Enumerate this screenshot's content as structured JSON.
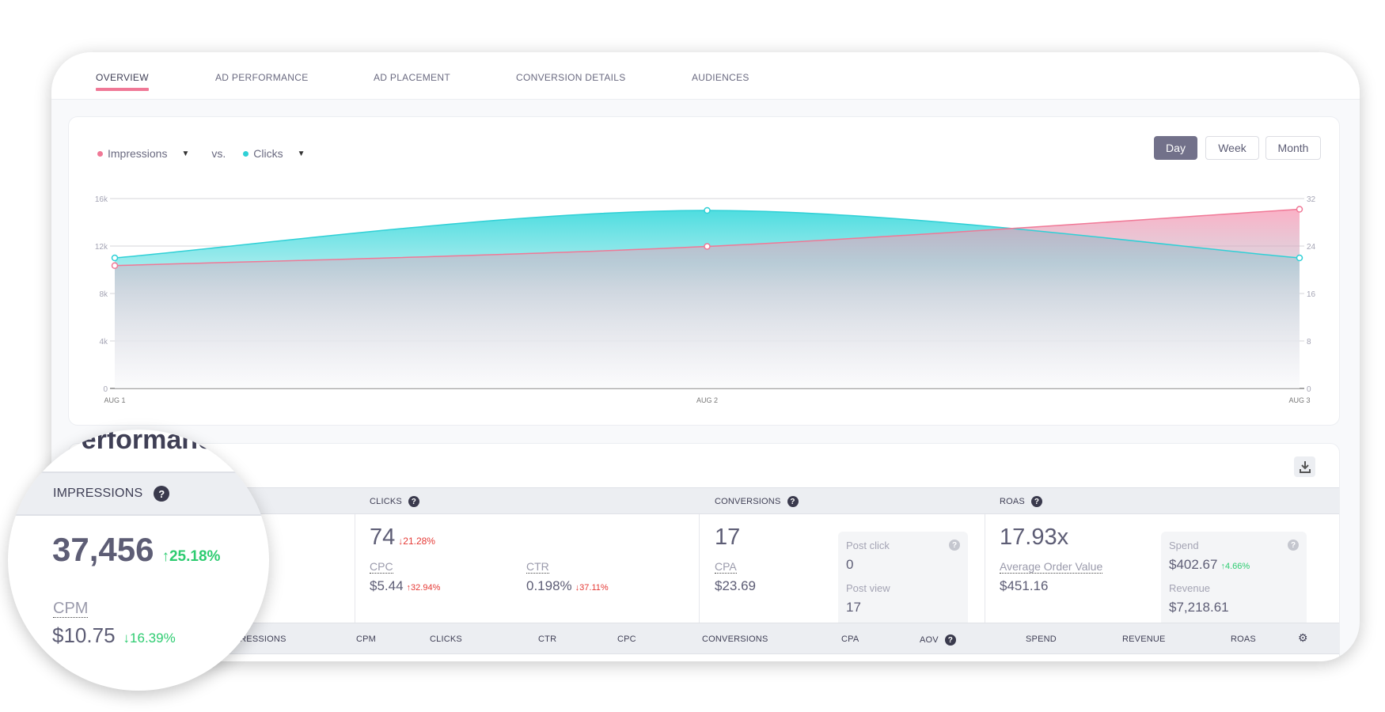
{
  "tabs": [
    {
      "label": "OVERVIEW",
      "active": true
    },
    {
      "label": "AD PERFORMANCE"
    },
    {
      "label": "AD PLACEMENT"
    },
    {
      "label": "CONVERSION DETAILS"
    },
    {
      "label": "AUDIENCES"
    }
  ],
  "legend": {
    "metric1": "Impressions",
    "vs": "vs.",
    "metric2": "Clicks"
  },
  "periods": {
    "day": "Day",
    "week": "Week",
    "month": "Month",
    "selected": "Day"
  },
  "colors": {
    "impressions": "#f07896",
    "clicks": "#2fd0d6",
    "up": "#2ecc71",
    "down": "#e53935"
  },
  "chart_data": {
    "type": "area",
    "x": [
      "AUG 1",
      "AUG 2",
      "AUG 3"
    ],
    "series": [
      {
        "name": "Impressions",
        "axis": "left",
        "values": [
          10350,
          11970,
          15100
        ]
      },
      {
        "name": "Clicks",
        "axis": "right",
        "values": [
          22,
          30,
          22
        ]
      }
    ],
    "y_left": {
      "ticks": [
        "0",
        "4k",
        "8k",
        "12k",
        "16k"
      ],
      "range": [
        0,
        16000
      ]
    },
    "y_right": {
      "ticks": [
        "0",
        "8",
        "16",
        "24",
        "32"
      ],
      "range": [
        0,
        32
      ]
    },
    "grid": true
  },
  "performance": {
    "title": "Performance",
    "headers": {
      "impressions": "IMPRESSIONS",
      "clicks": "CLICKS",
      "conversions": "CONVERSIONS",
      "roas": "ROAS"
    },
    "impressions": {
      "value": "37,456",
      "change": "25.18%",
      "cpm_label": "CPM",
      "cpm": "$10.75",
      "cpm_change": "16.39%"
    },
    "clicks": {
      "value": "74",
      "change": "21.28%",
      "cpc_label": "CPC",
      "cpc": "$5.44",
      "cpc_change": "32.94%",
      "ctr_label": "CTR",
      "ctr": "0.198%",
      "ctr_change": "37.11%"
    },
    "conversions": {
      "value": "17",
      "cpa_label": "CPA",
      "cpa": "$23.69",
      "post_click_label": "Post click",
      "post_click": "0",
      "post_view_label": "Post view",
      "post_view": "17"
    },
    "roas": {
      "value": "17.93x",
      "aov_label": "Average Order Value",
      "aov": "$451.16",
      "spend_label": "Spend",
      "spend": "$402.67",
      "spend_change": "4.66%",
      "revenue_label": "Revenue",
      "revenue": "$7,218.61"
    }
  },
  "table_headers": [
    "IMPRESSIONS",
    "CPM",
    "CLICKS",
    "CTR",
    "CPC",
    "CONVERSIONS",
    "CPA",
    "AOV",
    "SPEND",
    "REVENUE",
    "ROAS"
  ]
}
